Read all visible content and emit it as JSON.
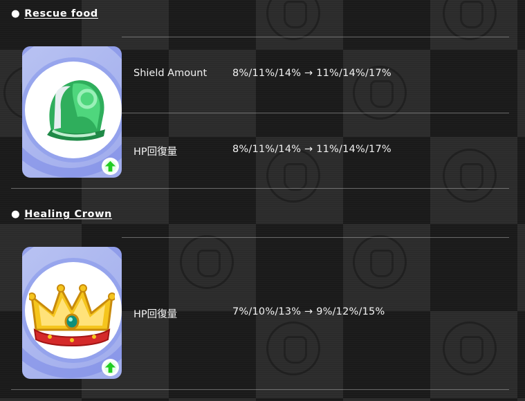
{
  "sections": [
    {
      "title": "Rescue food",
      "bullet": "●",
      "item_icon": "rescue-food-hood-icon",
      "badge_icon": "green-up-arrow-icon",
      "stats": [
        {
          "name": "Shield Amount",
          "value": "8%/11%/14% → 11%/14%/17%"
        },
        {
          "name": "HP回復量",
          "value": "8%/11%/14% → 11%/14%/17%"
        }
      ]
    },
    {
      "title": "Healing Crown",
      "bullet": "●",
      "item_icon": "healing-crown-icon",
      "badge_icon": "green-up-arrow-icon",
      "stats": [
        {
          "name": "HP回復量",
          "value": "7%/10%/13% → 9%/12%/15%"
        }
      ]
    }
  ],
  "colors": {
    "card_bg": "#b0bbf0",
    "up_arrow": "#22cc22",
    "crown_gold": "#f0c020",
    "hood_green": "#3bbf6a"
  }
}
